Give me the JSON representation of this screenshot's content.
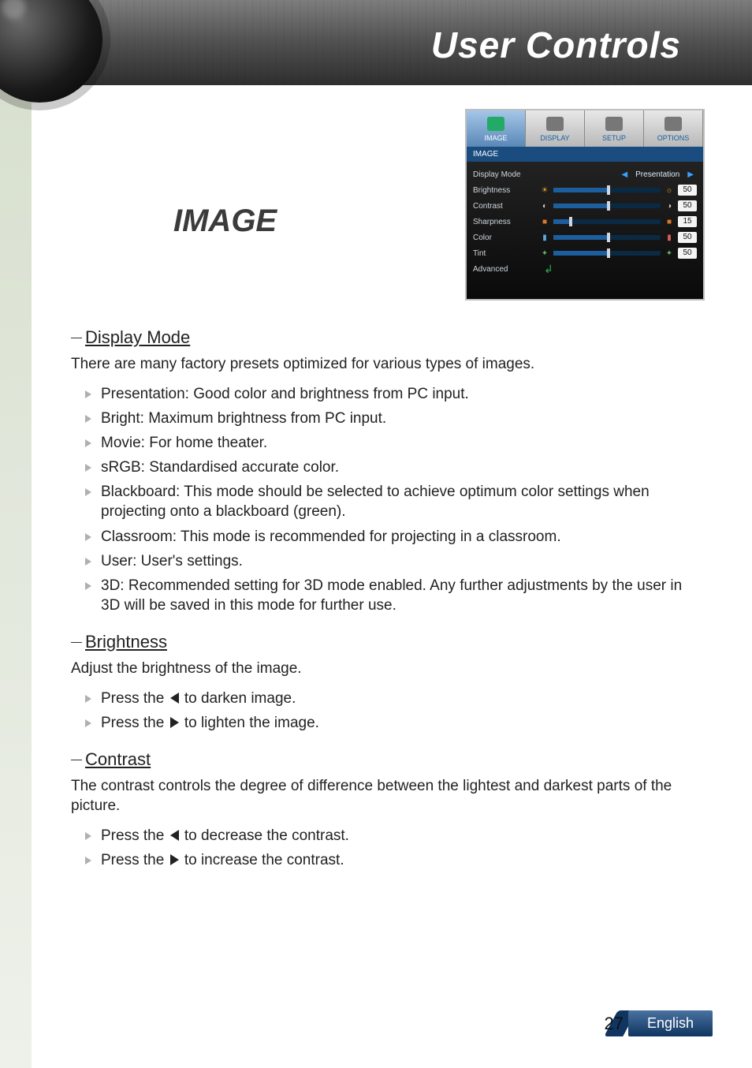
{
  "header": {
    "title": "User Controls"
  },
  "page": {
    "heading": "IMAGE",
    "number": "27",
    "language": "English"
  },
  "osd": {
    "tabs": [
      "IMAGE",
      "DISPLAY",
      "SETUP",
      "OPTIONS"
    ],
    "subtitle": "IMAGE",
    "rows": {
      "display_mode": {
        "label": "Display Mode",
        "value": "Presentation"
      },
      "brightness": {
        "label": "Brightness",
        "value": "50",
        "fill": 50
      },
      "contrast": {
        "label": "Contrast",
        "value": "50",
        "fill": 50
      },
      "sharpness": {
        "label": "Sharpness",
        "value": "15",
        "fill": 15
      },
      "color": {
        "label": "Color",
        "value": "50",
        "fill": 50
      },
      "tint": {
        "label": "Tint",
        "value": "50",
        "fill": 50
      },
      "advanced": {
        "label": "Advanced"
      }
    }
  },
  "sections": {
    "display_mode": {
      "title": "Display Mode",
      "intro": "There are many factory presets optimized for various types of images.",
      "items": [
        "Presentation: Good color and brightness from PC input.",
        "Bright: Maximum brightness from PC input.",
        "Movie: For home theater.",
        "sRGB: Standardised accurate color.",
        "Blackboard: This mode should be selected to achieve optimum color settings when projecting onto a blackboard (green).",
        "Classroom: This mode is recommended for projecting in a classroom.",
        "User: User's settings.",
        "3D: Recommended setting for 3D mode enabled. Any further adjustments by the user in 3D will be saved in this mode for further use."
      ]
    },
    "brightness": {
      "title": "Brightness",
      "intro": "Adjust the brightness of the image.",
      "item_pre1": "Press the ",
      "item_post1": " to darken image.",
      "item_pre2": "Press the ",
      "item_post2": " to lighten the image."
    },
    "contrast": {
      "title": "Contrast",
      "intro": "The contrast controls the degree of difference between the lightest and darkest parts of the picture.",
      "item_pre1": "Press the ",
      "item_post1": " to decrease the contrast.",
      "item_pre2": "Press the ",
      "item_post2": " to increase the contrast."
    }
  }
}
